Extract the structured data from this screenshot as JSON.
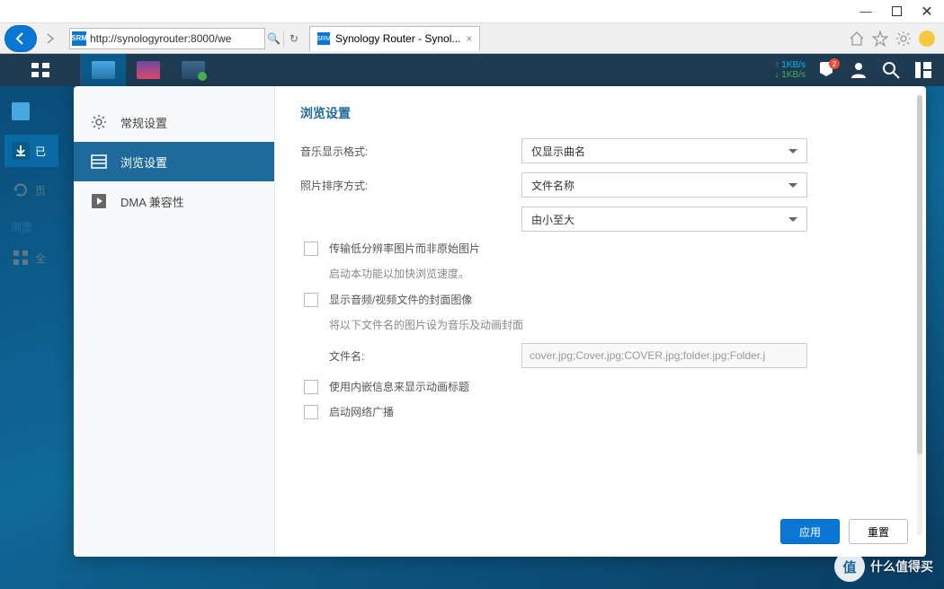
{
  "window": {
    "minimize": "—",
    "close": "✕"
  },
  "browser": {
    "url": "http://synologyrouter:8000/we",
    "search_icon": "🔍",
    "refresh": "↻",
    "tab_title": "Synology Router - Synol..."
  },
  "srm": {
    "net_up": "↑  1KB/s",
    "net_down": "↓  1KB/s",
    "badge": "2"
  },
  "dock": {
    "item1": "已",
    "item2": "页",
    "label": "浏览",
    "item3": "全"
  },
  "sidebar": {
    "general": "常规设置",
    "browse": "浏览设置",
    "dma": "DMA 兼容性"
  },
  "content": {
    "title": "浏览设置",
    "music_format_label": "音乐显示格式:",
    "music_format_value": "仅显示曲名",
    "photo_sort_label": "照片排序方式:",
    "photo_sort_value": "文件名称",
    "sort_order_value": "由小至大",
    "cb1": "传输低分辨率图片而非原始图片",
    "cb1_hint": "启动本功能以加快浏览速度。",
    "cb2": "显示音频/视频文件的封面图像",
    "cb2_hint": "将以下文件名的图片设为音乐及动画封面",
    "filename_label": "文件名:",
    "filename_value": "cover.jpg;Cover.jpg;COVER.jpg;folder.jpg;Folder.j",
    "cb3": "使用内嵌信息来显示动画标题",
    "cb4": "启动网络广播"
  },
  "footer": {
    "apply": "应用",
    "reset": "重置"
  },
  "watermark": {
    "circle": "值",
    "text": "什么值得买"
  }
}
